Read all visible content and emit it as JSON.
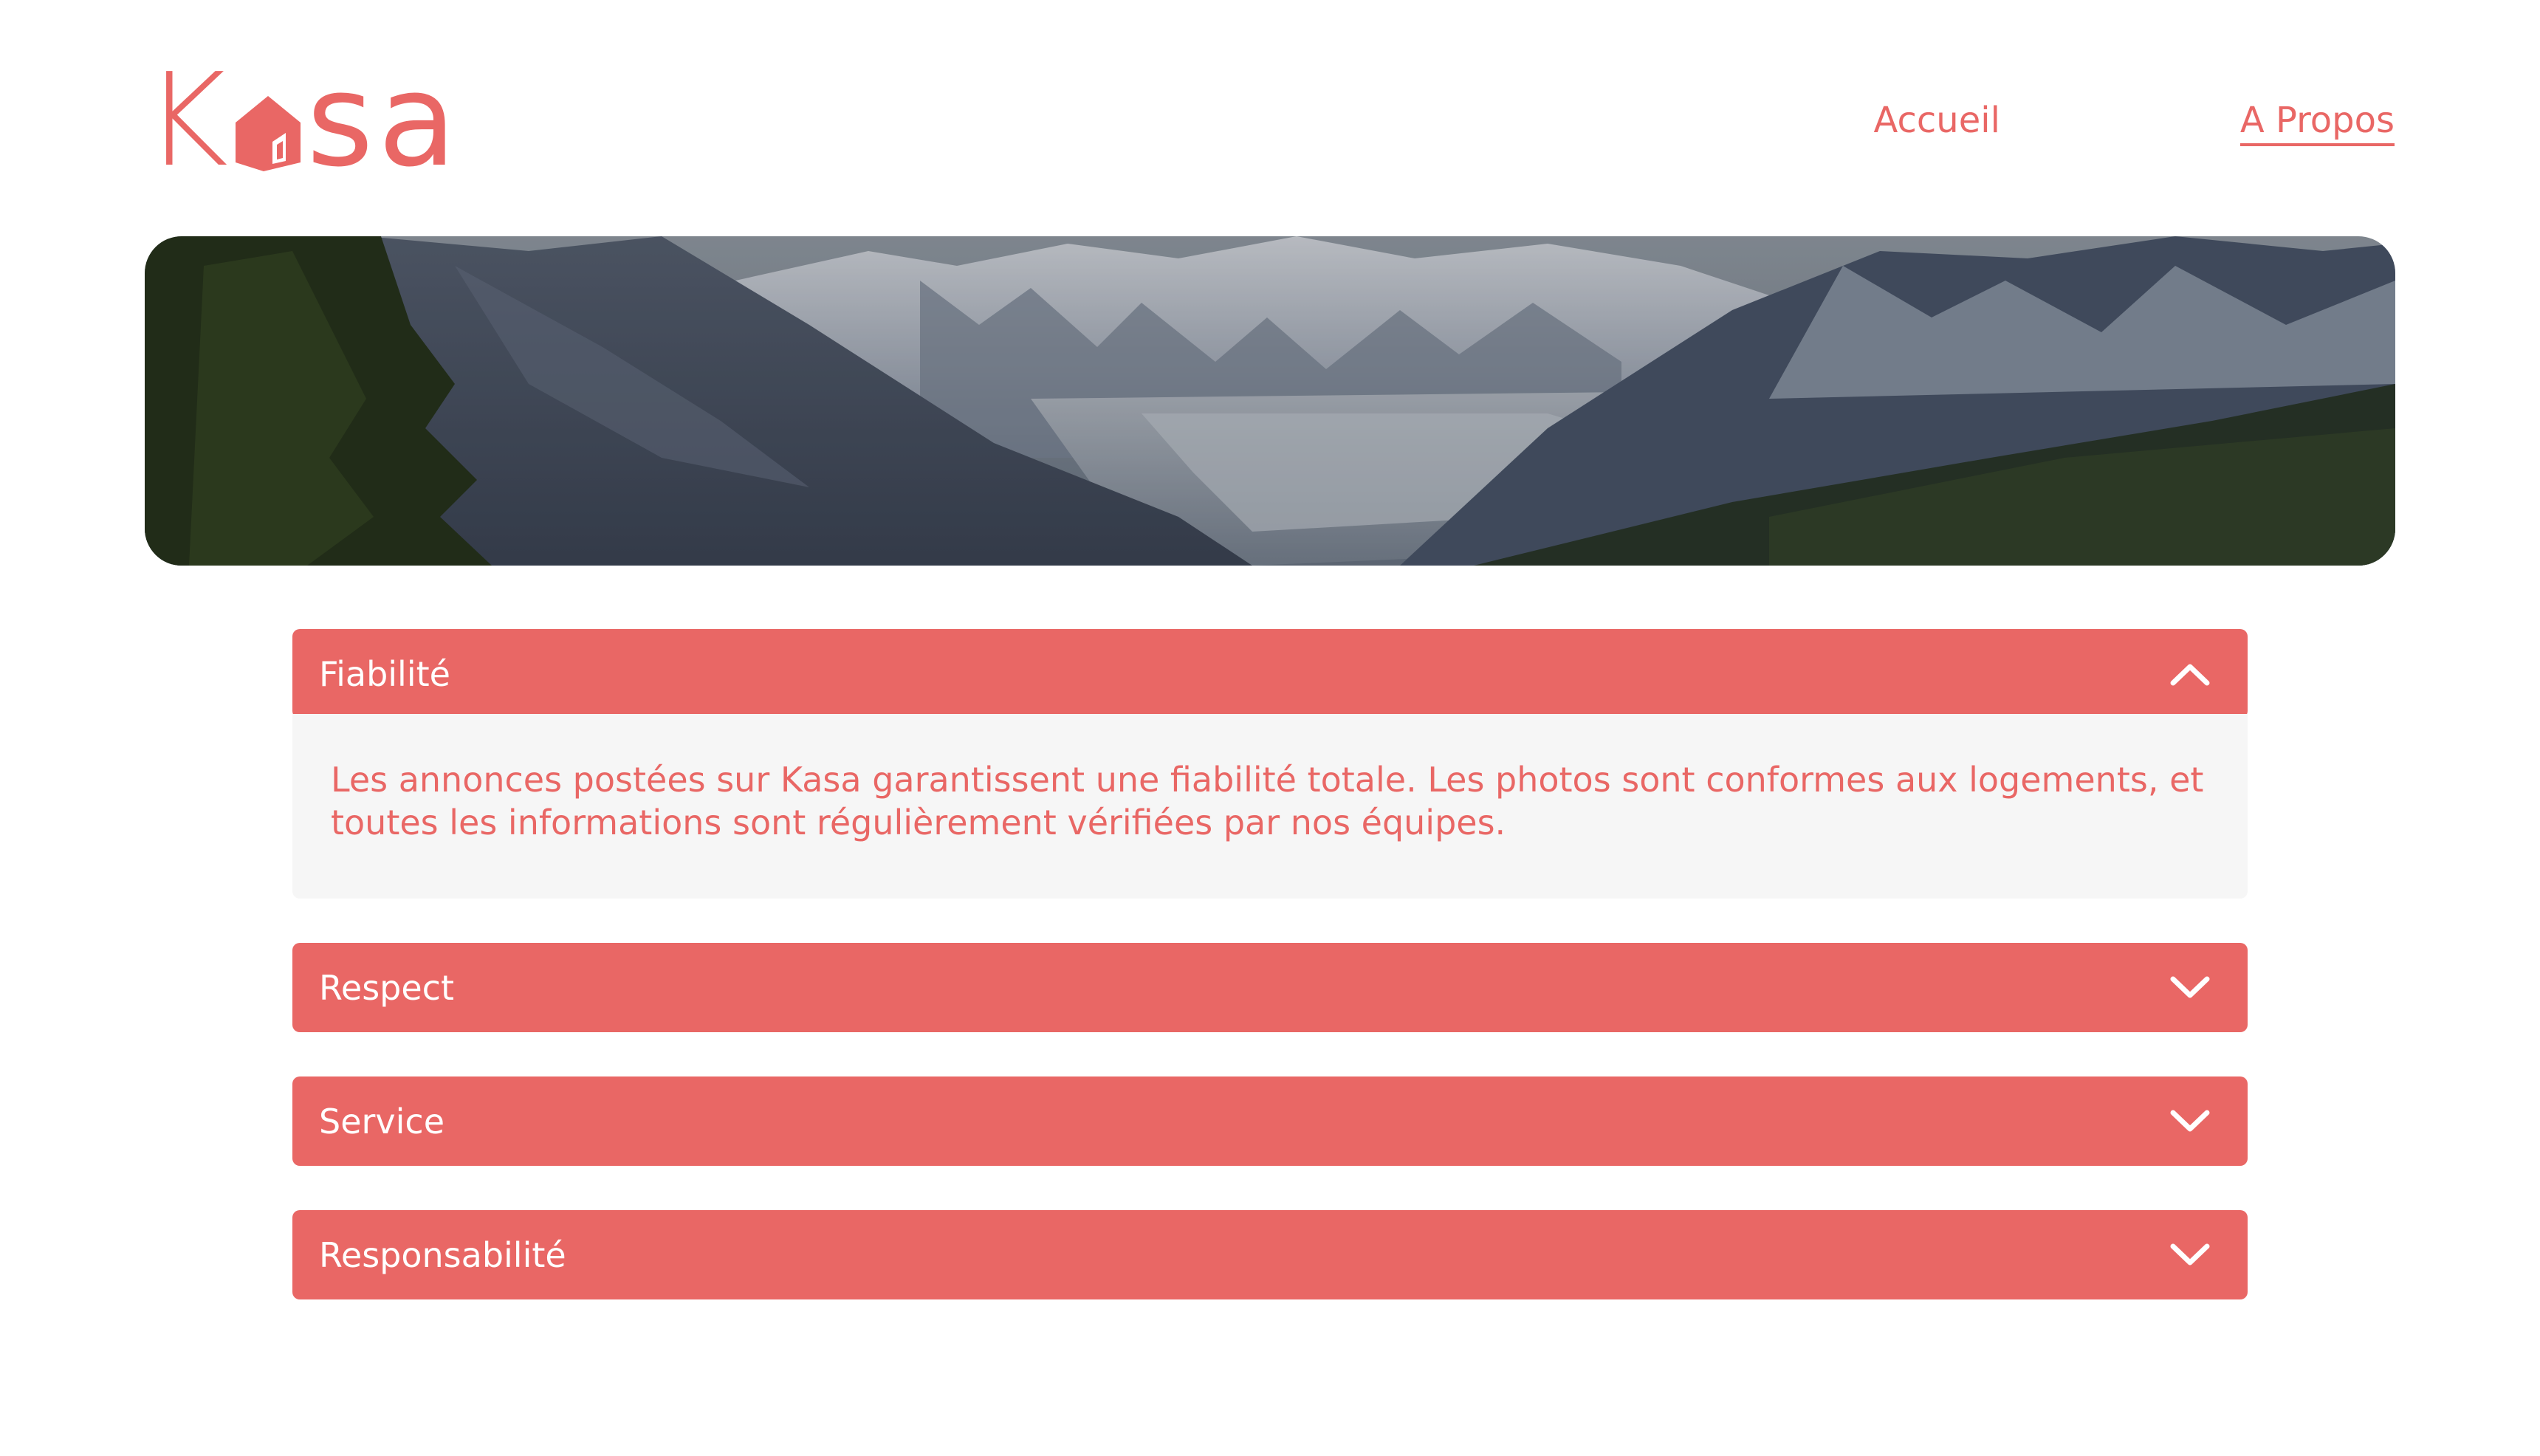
{
  "brand": {
    "name_left": "K",
    "name_right": "sa",
    "logo_icon": "house-icon",
    "color": "#E96765"
  },
  "nav": {
    "home": "Accueil",
    "about": "A Propos",
    "active": "about"
  },
  "banner": {
    "image": "mountain-valley-landscape"
  },
  "collapses": [
    {
      "title": "Fiabilité",
      "open": true,
      "icon": "chevron-up-icon",
      "content": "Les annonces postées sur Kasa garantissent une fiabilité totale. Les photos sont conformes aux logements, et toutes les informations sont régulièrement vérifiées par nos équipes."
    },
    {
      "title": "Respect",
      "open": false,
      "icon": "chevron-down-icon"
    },
    {
      "title": "Service",
      "open": false,
      "icon": "chevron-down-icon"
    },
    {
      "title": "Responsabilité",
      "open": false,
      "icon": "chevron-down-icon"
    }
  ],
  "colors": {
    "accent": "#E96765",
    "panel_bg": "#F6F6F6",
    "on_accent": "#FFFFFF"
  }
}
